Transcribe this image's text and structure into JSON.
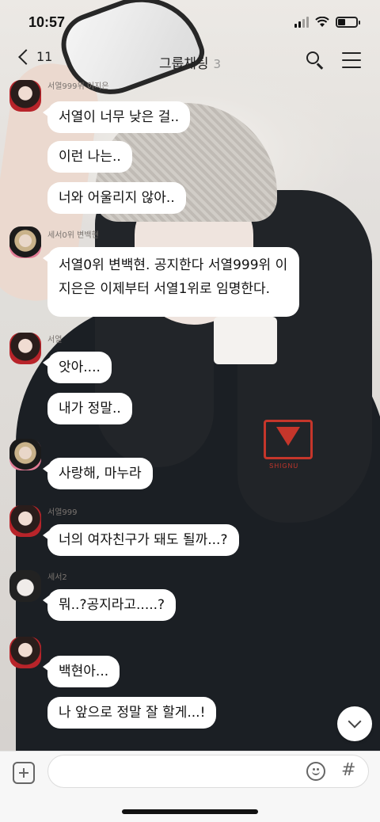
{
  "status_bar": {
    "time": "10:57"
  },
  "header": {
    "back_count": "11",
    "title": "그룹채팅",
    "member_count": "3"
  },
  "messages": [
    {
      "sender": "서열999위 이지은",
      "avatar": "g",
      "texts": [
        "서열이 너무 낮은 걸..",
        "이런 나는..",
        "너와 어울리지 않아.."
      ]
    },
    {
      "sender": "세서0위 변백현",
      "avatar": "b",
      "texts": [
        "서열0위 변백현. 공지한다 서열999위 이지은은 이제부터 서열1위로 임명한다."
      ]
    },
    {
      "sender": "서열",
      "avatar": "g",
      "texts": [
        "앗아....",
        "내가 정말.."
      ]
    },
    {
      "sender": "",
      "avatar": "b",
      "texts": [
        "사랑해, 마누라"
      ]
    },
    {
      "sender": "서열999",
      "avatar": "g",
      "texts": [
        "너의 여자친구가 돼도 될까...?"
      ]
    },
    {
      "sender": "세서2",
      "avatar": "c",
      "texts": [
        "뭐..?공지라고.....?"
      ]
    },
    {
      "sender": "",
      "avatar": "g",
      "texts": [
        "백현아...",
        "나 앞으로 정말 잘 할게...!"
      ]
    }
  ],
  "photo_logo_text": "SHIGNU",
  "input_bar": {
    "hash_label": "#"
  },
  "colors": {
    "bubble": "#ffffff",
    "header_text": "#222222",
    "input_bar_bg": "#f7f7f7"
  }
}
